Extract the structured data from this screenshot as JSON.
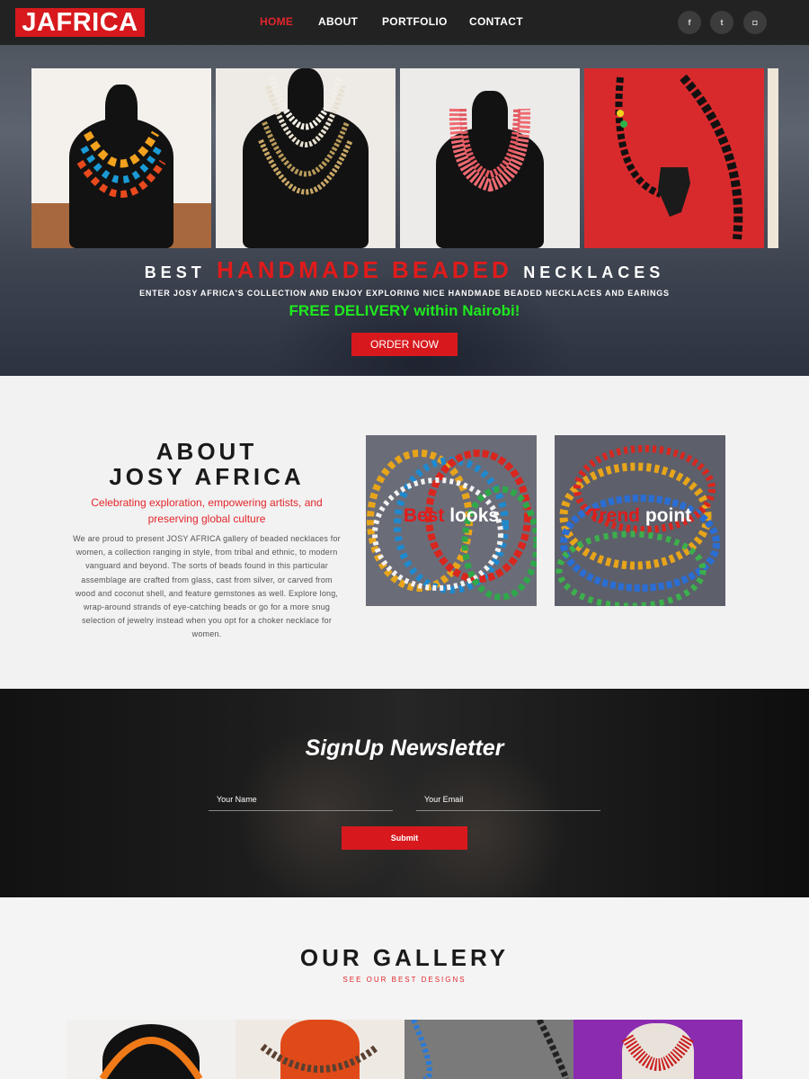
{
  "brand": {
    "logo_text": "JAFRICA",
    "accent": "#d7191d"
  },
  "nav": {
    "items": [
      {
        "label": "HOME",
        "active": true
      },
      {
        "label": "ABOUT",
        "active": false
      },
      {
        "label": "PORTFOLIO",
        "active": false
      },
      {
        "label": "CONTACT",
        "active": false
      }
    ],
    "social": [
      {
        "icon": "facebook-icon",
        "glyph": "f"
      },
      {
        "icon": "twitter-icon",
        "glyph": "t"
      },
      {
        "icon": "instagram-icon",
        "glyph": "◘"
      }
    ]
  },
  "hero": {
    "title_pre": "BEST",
    "title_highlight": "HANDMADE BEADED",
    "title_post": "NECKLACES",
    "subtitle": "ENTER JOSY AFRICA'S COLLECTION AND ENJOY EXPLORING NICE HANDMADE BEADED NECKLACES AND EARINGS",
    "delivery": "FREE DELIVERY within Nairobi!",
    "cta": "ORDER NOW",
    "slides": [
      "multicolor-tribal-necklace",
      "gold-white-multistrand-necklace",
      "coral-multistrand-necklace",
      "africa-pendant-bead-necklace"
    ]
  },
  "about": {
    "title_line1": "ABOUT",
    "title_line2": "JOSY AFRICA",
    "tagline": "Celebrating exploration, empowering artists, and preserving global culture",
    "body": "We are proud to present JOSY AFRICA gallery of beaded necklaces for women, a collection ranging in style, from tribal and ethnic, to modern vanguard and beyond. The sorts of beads found in this particular assemblage are crafted from glass, cast from silver, or carved from wood and coconut shell, and feature gemstones as well. Explore long, wrap-around strands of eye-catching beads or go for a more snug selection of jewelry instead when you opt for a choker necklace for women.",
    "tiles": [
      {
        "red": "Best",
        "white": "looks"
      },
      {
        "red": "Trend",
        "white": "point"
      }
    ]
  },
  "newsletter": {
    "title": "SignUp Newsletter",
    "name_placeholder": "Your Name",
    "email_placeholder": "Your Email",
    "submit": "Submit"
  },
  "gallery": {
    "title": "OUR GALLERY",
    "subtitle": "SEE OUR BEST DESIGNS"
  }
}
